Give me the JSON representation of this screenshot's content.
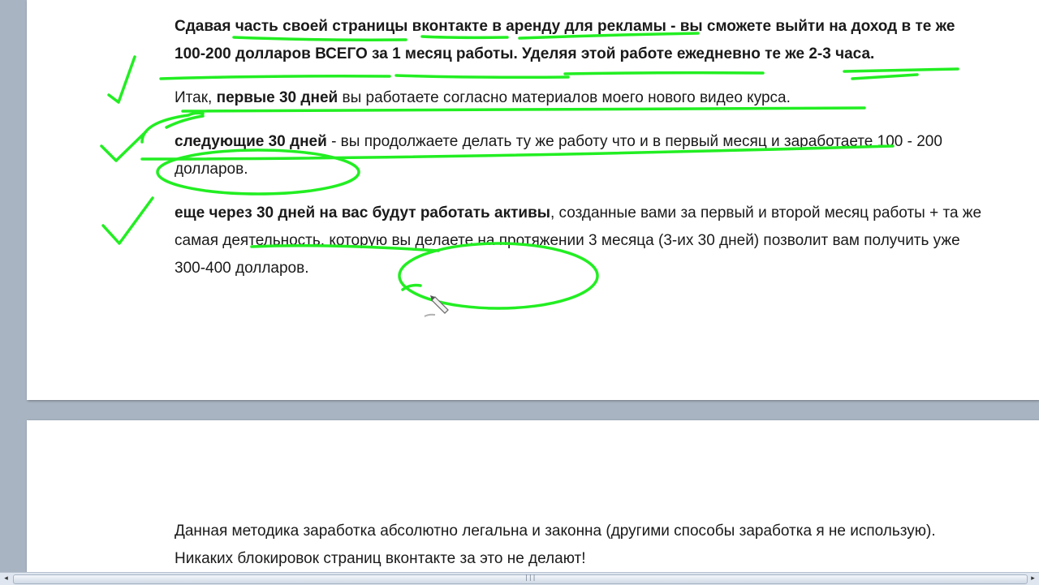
{
  "paragraphs": {
    "p1": {
      "s1": "Сдавая часть своей страницы вконтакте в аренду для рекламы",
      "s2": " - вы сможете выйти на доход в те же ",
      "s3": "100-200 долларов ВСЕГО за 1 месяц работы. Уделяя этой работе ежедневно те же 2-3 часа."
    },
    "p2": {
      "s1": "Итак, ",
      "s2": "первые 30 дней",
      "s3": " вы работаете согласно материалов моего нового видео курса."
    },
    "p3": {
      "s1": "следующие 30 дней",
      "s2": " - вы продолжаете делать ту же работу что и в первый месяц и заработаете 100 - 200 долларов."
    },
    "p4": {
      "s1": "еще через 30 дней на вас будут работать активы",
      "s2": ", созданные вами за первый и второй месяц работы + та же самая деятельность, которую вы делаете на протяжении 3 месяца (3-их 30 дней) позволит вам получить уже 300-400 долларов."
    },
    "p5": {
      "s1": "Данная методика заработка абсолютно легальна и законна (другими способы заработка я не использую). Никаких блокировок страниц вконтакте за это не делают!"
    }
  },
  "scrollbar": {
    "left_arrow": "◂",
    "right_arrow": "▸",
    "grip": "|||"
  },
  "colors": {
    "ink": "#22ee22",
    "page": "#ffffff",
    "background": "#a9b4c2"
  }
}
